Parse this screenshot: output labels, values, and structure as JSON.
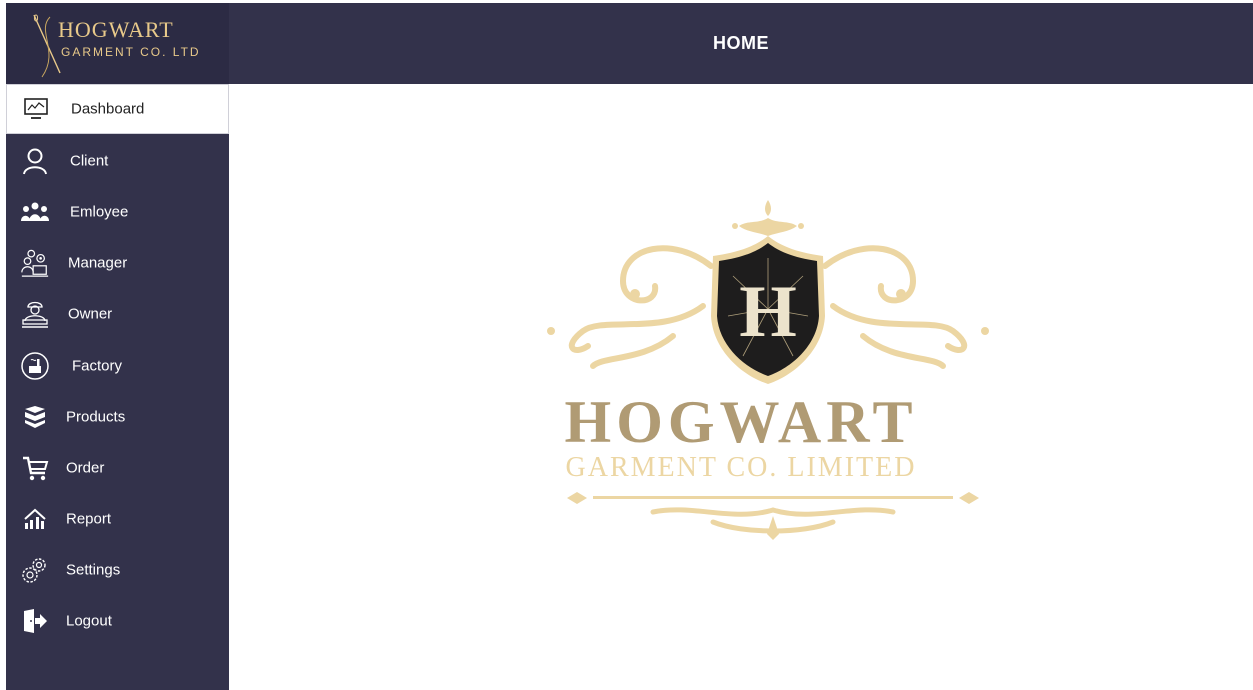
{
  "sidebar": {
    "logo": {
      "title": "HOGWART",
      "subtitle": "GARMENT CO. LTD"
    },
    "items": [
      {
        "label": "Dashboard",
        "icon": "dashboard-icon"
      },
      {
        "label": "Client",
        "icon": "user-icon"
      },
      {
        "label": "Emloyee",
        "icon": "employees-icon"
      },
      {
        "label": "Manager",
        "icon": "manager-icon"
      },
      {
        "label": "Owner",
        "icon": "owner-icon"
      },
      {
        "label": "Factory",
        "icon": "factory-icon"
      },
      {
        "label": "Products",
        "icon": "products-icon"
      },
      {
        "label": "Order",
        "icon": "cart-icon"
      },
      {
        "label": "Report",
        "icon": "report-icon"
      },
      {
        "label": "Settings",
        "icon": "settings-icon"
      },
      {
        "label": "Logout",
        "icon": "logout-icon"
      }
    ]
  },
  "header": {
    "title": "HOME"
  },
  "main": {
    "brand_title": "HOGWART",
    "brand_subtitle": "GARMENT CO. LIMITED",
    "crest_letter": "H"
  },
  "colors": {
    "sidebar": "#33324b",
    "header": "#33324b",
    "gold": "#e8c98a",
    "brand_text": "#b09b74"
  }
}
